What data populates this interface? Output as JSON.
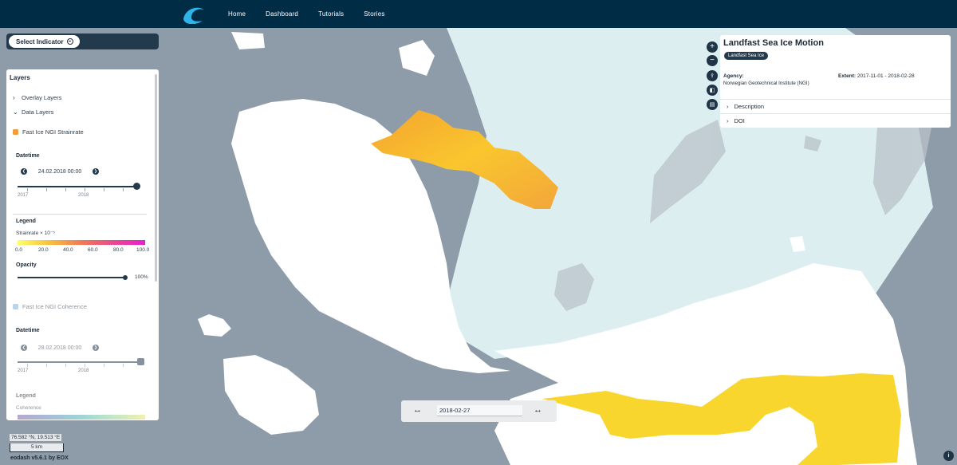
{
  "nav": {
    "home": "Home",
    "dashboard": "Dashboard",
    "tutorials": "Tutorials",
    "stories": "Stories",
    "logo_icon": "wave-logo-icon"
  },
  "select_indicator": {
    "label": "Select Indicator"
  },
  "layers": {
    "title": "Layers",
    "overlay": "Overlay Layers",
    "data": "Data Layers",
    "strainrate": {
      "name": "Fast Ice NGI Strainrate",
      "color": "#f59d3d",
      "datetime_label": "Datetime",
      "datetime_value": "24.02.2018 00:00",
      "ticks": [
        "2017",
        "2018"
      ],
      "legend_label": "Legend",
      "legend_title": "Strainrate × 10⁻⁵",
      "legend_ticks": [
        "0.0",
        "20.0",
        "40.0",
        "60.0",
        "80.0",
        "100.0"
      ],
      "opacity_label": "Opacity",
      "opacity_value": "100%"
    },
    "coherence": {
      "name": "Fast Ice NGI Coherence",
      "color": "#7fb4dc",
      "datetime_label": "Datetime",
      "datetime_value": "28.02.2018 00:00",
      "ticks": [
        "2017",
        "2018"
      ],
      "legend_label": "Legend",
      "legend_title": "Coherence"
    }
  },
  "info": {
    "title": "Landfast Sea Ice Motion",
    "chip": "Landfast Sea Ice",
    "agency_label": "Agency:",
    "agency_value": "Norwegian Geotechnical Institute (NGI)",
    "extent_label": "Extent:",
    "extent_value": "2017-11-01 - 2018-02-28",
    "description": "Description",
    "doi": "DOI"
  },
  "time_control": {
    "value": "2018-02-27"
  },
  "footer": {
    "coords": "76.582 °N, 19.513 °E",
    "scale": "5 km",
    "version": "eodash v5.6.1 by EOX"
  }
}
